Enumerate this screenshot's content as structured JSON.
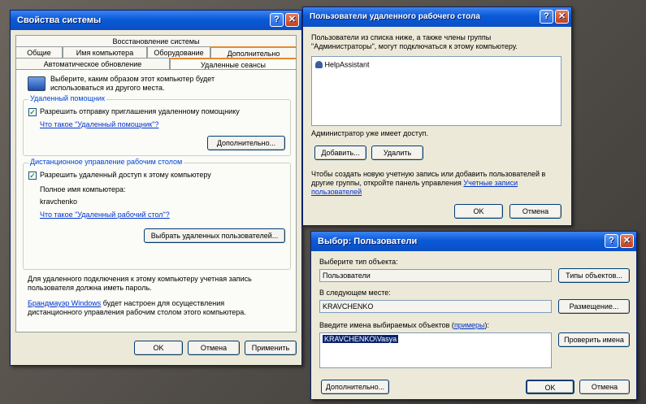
{
  "sysprops": {
    "title": "Свойства системы",
    "tabs_row1": [
      "Восстановление системы"
    ],
    "tabs_row2": [
      "Общие",
      "Имя компьютера",
      "Оборудование",
      "Дополнительно"
    ],
    "tabs_row3": [
      "Автоматическое обновление",
      "Удаленные сеансы"
    ],
    "intro": "Выберите, каким образом этот компьютер будет\nиспользоваться из другого места.",
    "assist_group": "Удаленный помощник",
    "assist_check": "Разрешить отправку приглашения удаленному помощнику",
    "assist_link": "Что такое \"Удаленный помощник\"?",
    "assist_more": "Дополнительно...",
    "desk_group": "Дистанционное управление рабочим столом",
    "desk_check": "Разрешить удаленный доступ к этому компьютеру",
    "fullname_label": "Полное имя компьютера:",
    "fullname_value": "kravchenko",
    "desk_link": "Что такое \"Удаленный рабочий стол\"?",
    "select_users": "Выбрать удаленных пользователей...",
    "password_note": "Для удаленного подключения к этому компьютеру учетная запись\nпользователя должна иметь пароль.",
    "firewall_link": "Брандмауэр Windows",
    "firewall_note": " будет настроен для осуществления",
    "firewall_note2": "дистанционного управления рабочим столом этого компьютера.",
    "ok": "OK",
    "cancel": "Отмена",
    "apply": "Применить"
  },
  "rdusers": {
    "title": "Пользователи удаленного рабочего стола",
    "intro": "Пользователи из списка ниже, а также члены группы\n\"Администраторы\", могут подключаться к этому компьютеру.",
    "list_item": "HelpAssistant",
    "admin_note": "Администратор уже имеет доступ.",
    "add": "Добавить...",
    "remove": "Удалить",
    "create_note": "Чтобы создать новую учетную запись или добавить пользователей в",
    "create_note2": "другие группы, откройте панель управления ",
    "accounts_link": "Учетные записи",
    "accounts_link2": "пользователей",
    "ok": "OK",
    "cancel": "Отмена"
  },
  "selectusers": {
    "title": "Выбор: Пользователи",
    "type_label": "Выберите тип объекта:",
    "type_value": "Пользователи",
    "types_button": "Типы объектов...",
    "location_label": "В следующем месте:",
    "location_value": "KRAVCHENKO",
    "location_button": "Размещение...",
    "names_label": "Введите имена выбираемых объектов (",
    "names_link": "примеры",
    "names_label_end": "):",
    "names_value": "KRAVCHENKO\\Vasya",
    "check_names": "Проверить имена",
    "advanced": "Дополнительно...",
    "ok": "OK",
    "cancel": "Отмена"
  }
}
